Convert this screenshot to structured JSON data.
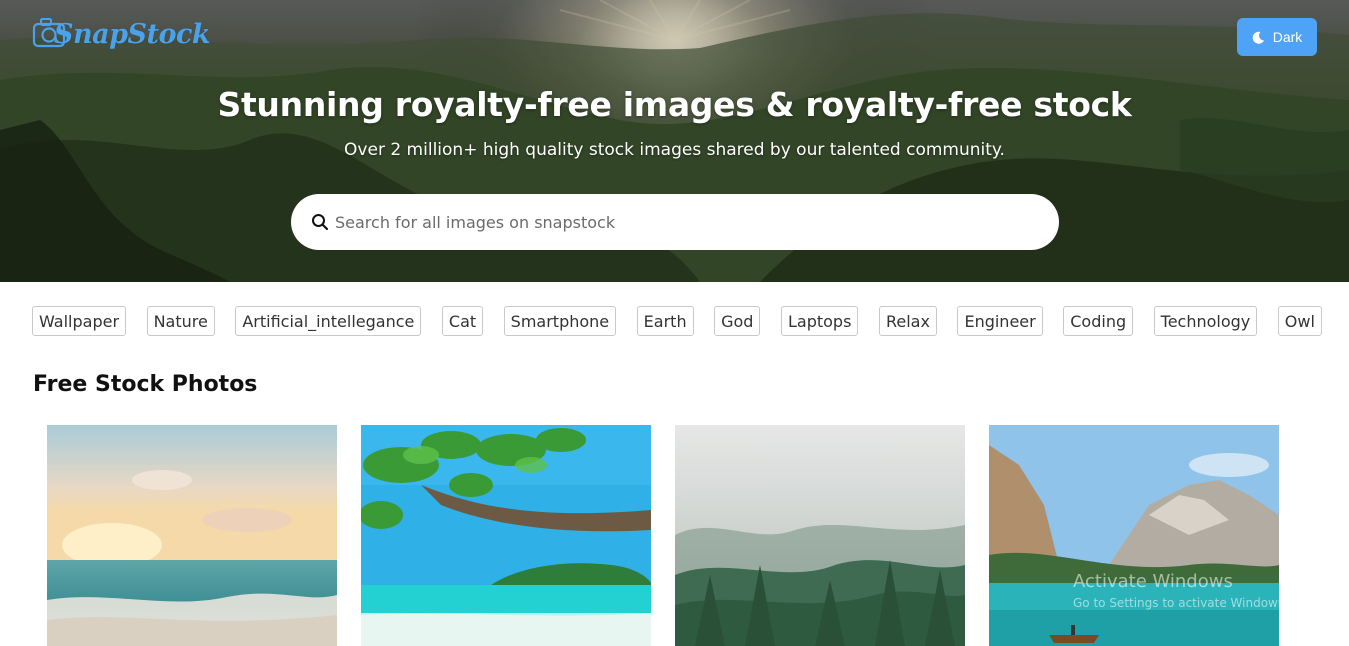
{
  "brand": {
    "name": "SnapStock"
  },
  "theme_toggle": {
    "label": "Dark",
    "icon": "moon-icon",
    "color": "#4ea3f7"
  },
  "hero": {
    "title": "Stunning royalty-free images & royalty-free stock",
    "subtitle": "Over 2 million+ high quality stock images shared by our talented community.",
    "search": {
      "placeholder": "Search for all images on snapstock",
      "icon": "search-icon"
    }
  },
  "tags": [
    "Wallpaper",
    "Nature",
    "Artificial_intellegance",
    "Cat",
    "Smartphone",
    "Earth",
    "God",
    "Laptops",
    "Relax",
    "Engineer",
    "Coding",
    "Technology",
    "Owl"
  ],
  "section": {
    "title": "Free Stock Photos"
  },
  "photos": [
    {
      "subject": "beach-sunset"
    },
    {
      "subject": "tropical-beach-island"
    },
    {
      "subject": "foggy-forest"
    },
    {
      "subject": "mountain-lake-boat"
    }
  ],
  "os_watermark": {
    "line1": "Activate Windows",
    "line2": "Go to Settings to activate Windows."
  }
}
